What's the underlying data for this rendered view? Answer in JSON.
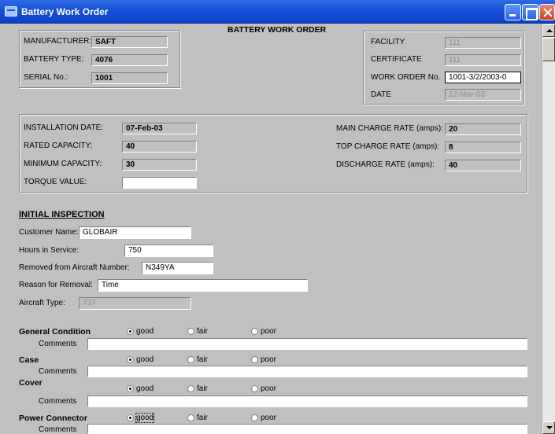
{
  "window": {
    "title": "Battery Work Order"
  },
  "form_title": "BATTERY WORK ORDER",
  "battery": {
    "manufacturer_label": "MANUFACTURER:",
    "manufacturer": "SAFT",
    "type_label": "BATTERY TYPE:",
    "type": "4076",
    "serial_label": "SERIAL No.:",
    "serial": "1001"
  },
  "facility": {
    "facility_label": "FACILITY",
    "facility": "111",
    "certificate_label": "CERTIFICATE",
    "certificate": "111",
    "work_order_label": "WORK ORDER No.",
    "work_order": "1001-3/2/2003-0",
    "date_label": "DATE",
    "date": "12-Mar-03"
  },
  "specs": {
    "installation_date_label": "INSTALLATION DATE:",
    "installation_date": "07-Feb-03",
    "rated_capacity_label": "RATED CAPACITY:",
    "rated_capacity": "40",
    "minimum_capacity_label": "MINIMUM CAPACITY:",
    "minimum_capacity": "30",
    "torque_value_label": "TORQUE VALUE:",
    "torque_value": "",
    "main_charge_label": "MAIN CHARGE RATE (amps):",
    "main_charge": "20",
    "top_charge_label": "TOP CHARGE RATE (amps):",
    "top_charge": "8",
    "discharge_label": "DISCHARGE RATE (amps):",
    "discharge": "40"
  },
  "inspection": {
    "heading": "INITIAL INSPECTION",
    "customer_label": "Customer Name:",
    "customer": "GLOBAIR",
    "hours_label": "Hours in Service:",
    "hours": "750",
    "aircraft_number_label": "Removed from Aircraft Number:",
    "aircraft_number": "N349YA",
    "reason_label": "Reason for Removal:",
    "reason": "Time",
    "aircraft_type_label": "Aircraft Type:",
    "aircraft_type": "737"
  },
  "options": {
    "good": "good",
    "fair": "fair",
    "poor": "poor"
  },
  "comments_label": "Comments",
  "conditions": [
    {
      "label": "General Condition",
      "selected": "good",
      "comment": ""
    },
    {
      "label": "Case",
      "selected": "good",
      "comment": ""
    },
    {
      "label": "Cover",
      "selected": "good",
      "comment": ""
    },
    {
      "label": "Power Connector",
      "selected": "good",
      "comment": ""
    }
  ]
}
